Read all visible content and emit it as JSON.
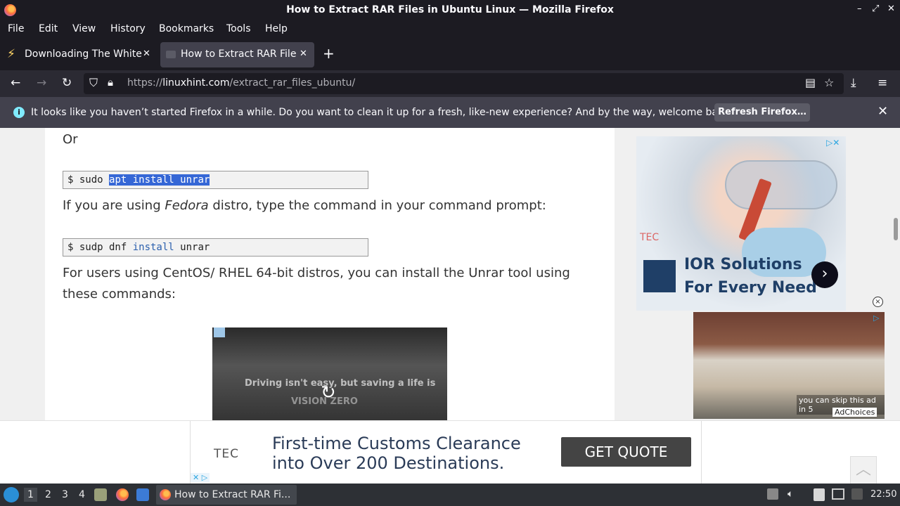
{
  "window": {
    "title": "How to Extract RAR Files in Ubuntu Linux — Mozilla Firefox",
    "controls": {
      "minimize": "–",
      "restore": "⤢",
      "close": "✕"
    }
  },
  "menubar": [
    "File",
    "Edit",
    "View",
    "History",
    "Bookmarks",
    "Tools",
    "Help"
  ],
  "tabs": [
    {
      "label": "Downloading The White H",
      "close": "✕",
      "active": false
    },
    {
      "label": "How to Extract RAR Files",
      "close": "✕",
      "active": true
    }
  ],
  "newtab_label": "+",
  "urlbar": {
    "prefix": "https://",
    "host": "linuxhint.com",
    "path": "/extract_rar_files_ubuntu/"
  },
  "notification": {
    "info_icon": "i",
    "message": "It looks like you haven’t started Firefox in a while. Do you want to clean it up for a fresh, like-new experience? And by the way, welcome back!",
    "button": "Refresh Firefox…",
    "close": "✕"
  },
  "article": {
    "or_text": "Or",
    "code1": {
      "prompt": "$ sudo ",
      "selected": "apt install unrar"
    },
    "fedora_pre": "If you are using ",
    "fedora_em": "Fedora",
    "fedora_post": " distro, type the command in your command prompt:",
    "code2": {
      "prompt": "$ sudp dnf ",
      "kw": "install",
      "rest": " unrar"
    },
    "centos_line1": "For users using CentOS/ RHEL 64-bit distros, you can install the Unrar tool using",
    "centos_line2": "these commands:"
  },
  "video_ad": {
    "text1": "Driving isn't easy, but saving a life is",
    "text2": "VISION ZERO",
    "replay": "↻"
  },
  "side_ad": {
    "brand": "TEC",
    "line1": "IOR Solutions",
    "line2": "For Every Need",
    "arrow": "›",
    "adchoices": "▷✕"
  },
  "close_ad": "×",
  "video_ad2": {
    "skip": "you can skip this ad in 5",
    "adchoices": "AdChoices",
    "tag": "▷"
  },
  "banner": {
    "brand": "TEC",
    "line1": "First-time Customs Clearance",
    "line2": "into Over 200 Destinations.",
    "cta": "GET QUOTE",
    "adx": "✕ ▷",
    "totop": "︿"
  },
  "taskbar": {
    "workspaces": [
      "1",
      "2",
      "3",
      "4"
    ],
    "active_task": "How to Extract RAR Fi...",
    "clock": "22:50"
  },
  "colors": {
    "accent": "#3567d6",
    "firefox_dark": "#1c1b22",
    "notification": "#42414d"
  }
}
